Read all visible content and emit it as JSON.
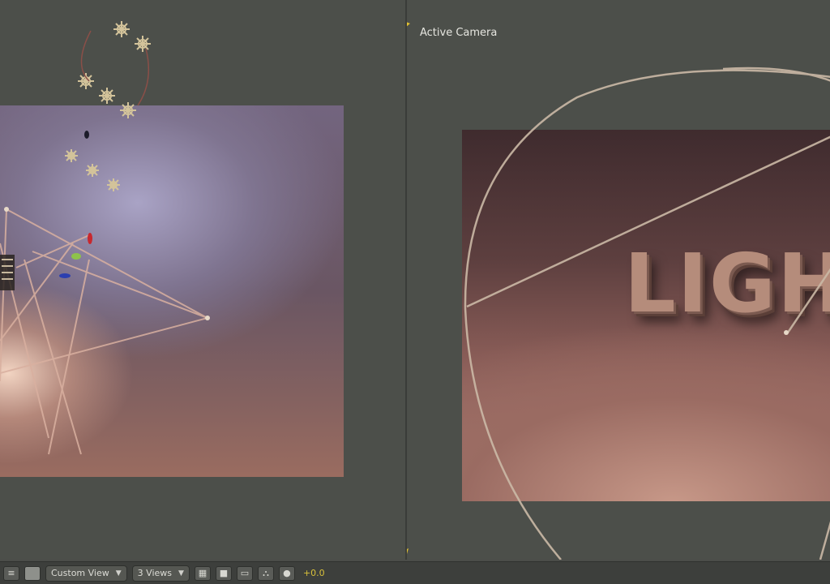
{
  "left_viewport": {
    "name": "perspective-view"
  },
  "right_viewport": {
    "camera_label": "Active Camera",
    "render_text": "LIGH"
  },
  "toolbar": {
    "view_dropdown": "Custom View",
    "views_dropdown": "3 Views",
    "coord_readout": "+0.0"
  },
  "colors": {
    "background": "#4b4d49",
    "accent_yellow": "#d9c13a",
    "gizmo_lines": "#d9b0a0",
    "light_marker": "#c8b58a"
  },
  "icons": [
    "camera-marker-icon",
    "light-icon",
    "grid-icon",
    "render-icon",
    "snap-icon",
    "hierarchy-icon",
    "dot-icon"
  ]
}
